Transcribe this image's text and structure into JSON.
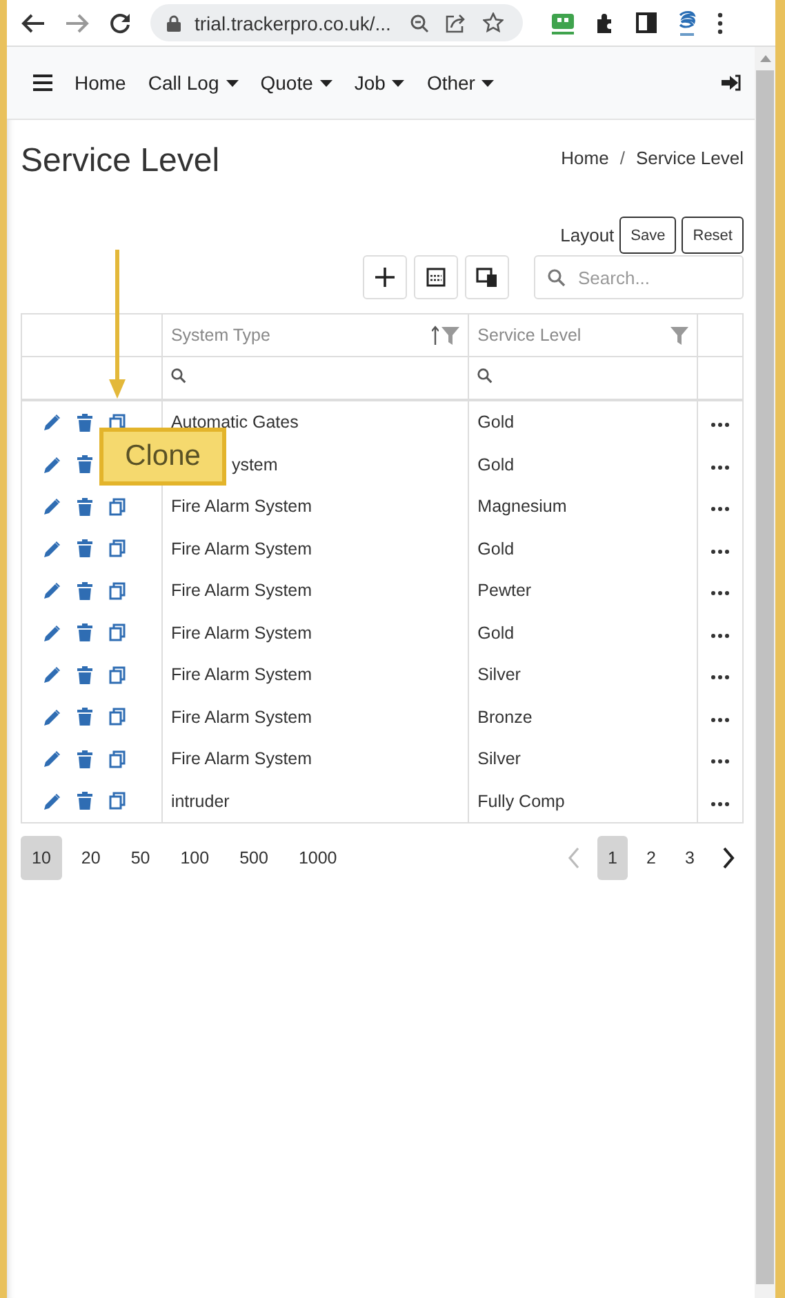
{
  "browser": {
    "url": "trial.trackerpro.co.uk/...",
    "forward_disabled": true
  },
  "nav": {
    "items": [
      {
        "label": "Home",
        "dropdown": false
      },
      {
        "label": "Call Log",
        "dropdown": true
      },
      {
        "label": "Quote",
        "dropdown": true
      },
      {
        "label": "Job",
        "dropdown": true
      },
      {
        "label": "Other",
        "dropdown": true
      }
    ]
  },
  "page": {
    "title": "Service Level",
    "breadcrumb_separator": "/",
    "breadcrumb": [
      {
        "label": "Home"
      },
      {
        "label": "Service Level"
      }
    ]
  },
  "layout": {
    "label": "Layout",
    "buttons": [
      "Save",
      "Reset"
    ]
  },
  "search": {
    "placeholder": "Search..."
  },
  "table": {
    "columns": [
      {
        "label": "System Type",
        "sorted": true
      },
      {
        "label": "Service Level",
        "sorted": false
      }
    ],
    "rows": [
      {
        "system_type": "Automatic Gates",
        "service_level": "Gold"
      },
      {
        "system_type": "ystem",
        "service_level": "Gold",
        "copy_icon_covered": true
      },
      {
        "system_type": "Fire Alarm System",
        "service_level": "Magnesium"
      },
      {
        "system_type": "Fire Alarm System",
        "service_level": "Gold"
      },
      {
        "system_type": "Fire Alarm System",
        "service_level": "Pewter"
      },
      {
        "system_type": "Fire Alarm System",
        "service_level": "Gold"
      },
      {
        "system_type": "Fire Alarm System",
        "service_level": "Silver"
      },
      {
        "system_type": "Fire Alarm System",
        "service_level": "Bronze"
      },
      {
        "system_type": "Fire Alarm System",
        "service_level": "Silver"
      },
      {
        "system_type": "intruder",
        "service_level": "Fully Comp"
      }
    ]
  },
  "callout": {
    "text": "Clone"
  },
  "pagination": {
    "page_sizes": [
      {
        "label": "10",
        "selected": true
      },
      {
        "label": "20",
        "selected": false
      },
      {
        "label": "50",
        "selected": false
      },
      {
        "label": "100",
        "selected": false
      },
      {
        "label": "500",
        "selected": false
      },
      {
        "label": "1000",
        "selected": false
      }
    ],
    "pages": [
      {
        "label": "1",
        "selected": true
      },
      {
        "label": "2",
        "selected": false
      },
      {
        "label": "3",
        "selected": false
      }
    ],
    "prev_disabled": true
  }
}
